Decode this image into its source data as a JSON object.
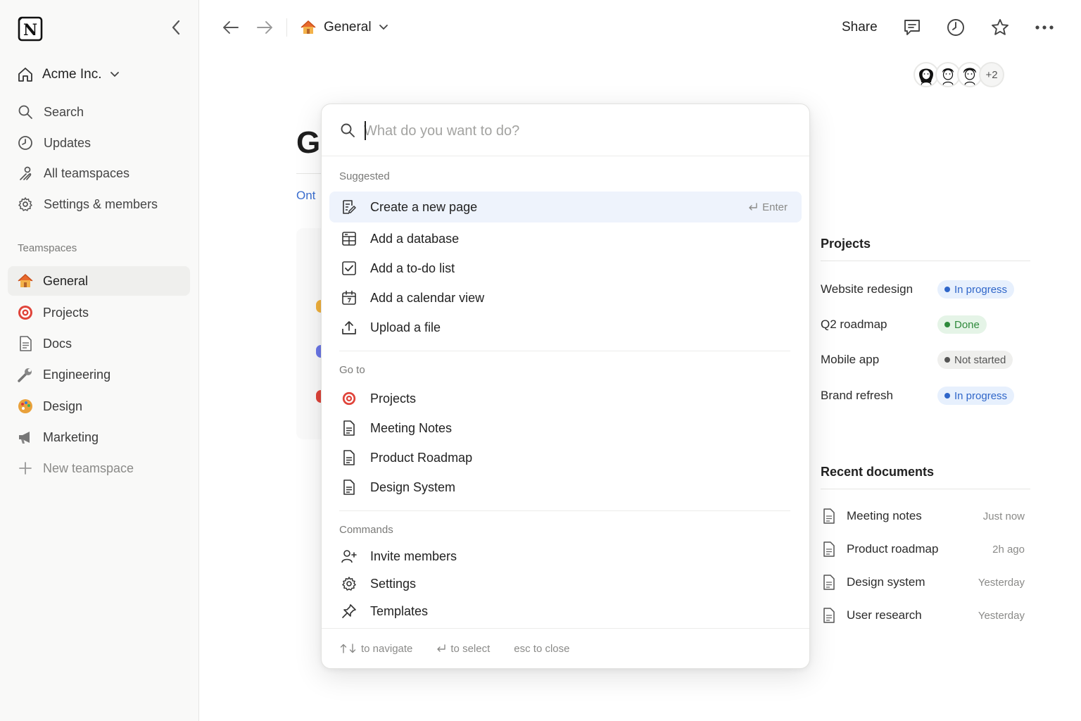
{
  "sidebar": {
    "workspace": "Acme Inc.",
    "nav": [
      {
        "label": "Search",
        "icon": "search-icon"
      },
      {
        "label": "Updates",
        "icon": "clock-icon"
      },
      {
        "label": "All teamspaces",
        "icon": "teamspaces-icon"
      },
      {
        "label": "Settings & members",
        "icon": "gear-icon"
      }
    ],
    "teamspaces_heading": "Teamspaces",
    "teamspaces": [
      {
        "label": "General",
        "icon": "house-icon",
        "active": true
      },
      {
        "label": "Projects",
        "icon": "target-icon"
      },
      {
        "label": "Docs",
        "icon": "document-icon"
      },
      {
        "label": "Engineering",
        "icon": "wrench-icon"
      },
      {
        "label": "Design",
        "icon": "palette-icon"
      },
      {
        "label": "Marketing",
        "icon": "megaphone-icon"
      }
    ],
    "new_teamspace": "New teamspace"
  },
  "topbar": {
    "breadcrumb": "General",
    "share": "Share",
    "avatars_more": "+2"
  },
  "page": {
    "title_fragment": "G",
    "tab_fragment": "Ont"
  },
  "projects_panel": {
    "title": "Projects",
    "rows": [
      {
        "name": "Website redesign",
        "status": "In progress"
      },
      {
        "name": "Q2 roadmap",
        "status": "Done"
      },
      {
        "name": "Mobile app",
        "status": "Not started"
      },
      {
        "name": "Brand refresh",
        "status": "In progress"
      }
    ]
  },
  "recent_panel": {
    "title": "Recent documents",
    "rows": [
      {
        "name": "Meeting notes",
        "time": "Just now"
      },
      {
        "name": "Product roadmap",
        "time": "2h ago"
      },
      {
        "name": "Design system",
        "time": "Yesterday"
      },
      {
        "name": "User research",
        "time": "Yesterday"
      }
    ]
  },
  "palette": {
    "placeholder": "What do you want to do?",
    "suggested_heading": "Suggested",
    "suggested": [
      {
        "label": "Create a new page",
        "icon": "new-page-icon",
        "shortcut": "Enter"
      },
      {
        "label": "Add a database",
        "icon": "database-icon"
      },
      {
        "label": "Add a to-do list",
        "icon": "checkbox-icon"
      },
      {
        "label": "Add a calendar view",
        "icon": "calendar-icon"
      },
      {
        "label": "Upload a file",
        "icon": "upload-icon"
      }
    ],
    "goto_heading": "Go to",
    "goto": [
      {
        "label": "Projects",
        "icon": "target-icon"
      },
      {
        "label": "Meeting Notes",
        "icon": "document-icon"
      },
      {
        "label": "Product Roadmap",
        "icon": "document-icon"
      },
      {
        "label": "Design System",
        "icon": "document-icon"
      }
    ],
    "commands_heading": "Commands",
    "commands": [
      {
        "label": "Invite members",
        "icon": "add-user-icon"
      },
      {
        "label": "Settings",
        "icon": "gear-icon"
      },
      {
        "label": "Templates",
        "icon": "pin-icon"
      }
    ],
    "footer": {
      "navigate": "to navigate",
      "select": "to select",
      "close": "esc to close"
    }
  },
  "colors": {
    "accent": "#3b6fd1",
    "highlight": "#eef3fc",
    "status_in_progress_bg": "#e7f0fd",
    "status_in_progress_fg": "#2f66c9",
    "status_done_bg": "#e5f4e7",
    "status_done_fg": "#2f8a3c",
    "status_not_started_bg": "#efefed",
    "status_not_started_fg": "#555555"
  }
}
